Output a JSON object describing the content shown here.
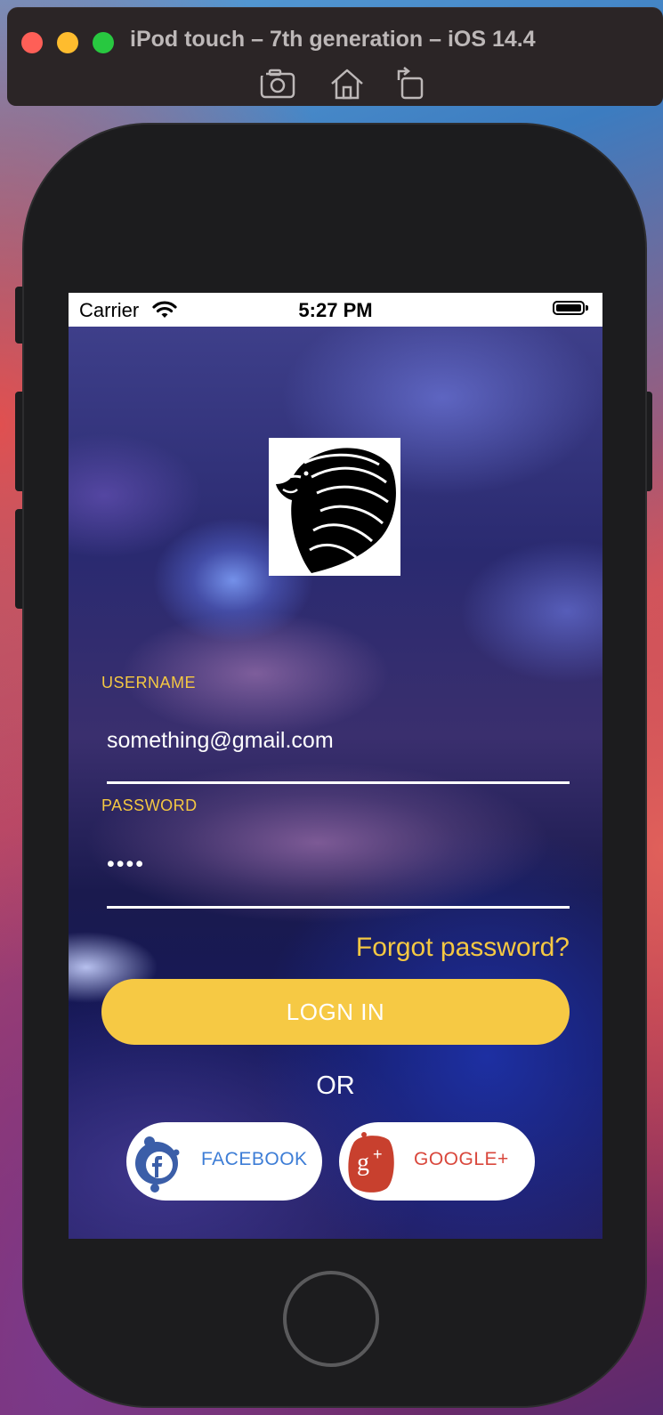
{
  "window": {
    "title": "iPod touch – 7th generation – iOS 14.4",
    "toolbar_icons": [
      "screenshot-icon",
      "home-icon",
      "rotate-icon"
    ]
  },
  "status_bar": {
    "carrier": "Carrier",
    "time": "5:27 PM"
  },
  "login": {
    "username_label": "USERNAME",
    "username_value": "something@gmail.com",
    "password_label": "PASSWORD",
    "password_value": "••••",
    "forgot_label": "Forgot password?",
    "login_button": "LOGN IN",
    "or_text": "OR",
    "facebook_label": "FACEBOOK",
    "google_label": "GOOGLE+"
  },
  "colors": {
    "accent": "#f6c944",
    "facebook": "#3d7dd6",
    "google": "#d9473c"
  }
}
